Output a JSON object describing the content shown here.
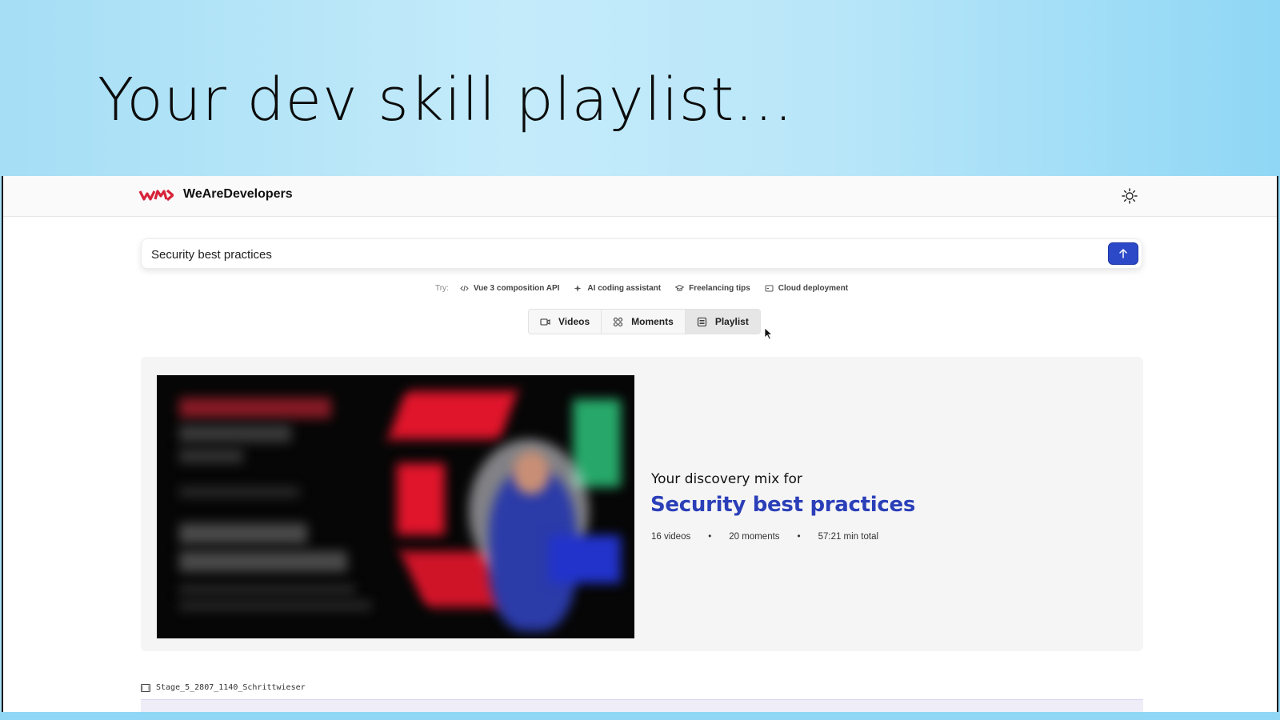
{
  "slide": {
    "title": "Your dev skill playlist..."
  },
  "header": {
    "brand": "WeAreDevelopers",
    "logo_icon": "wad-logo-icon",
    "theme_icon": "sun-icon"
  },
  "search": {
    "value": "Security best practices",
    "submit_icon": "arrow-up-icon"
  },
  "suggestions": {
    "label": "Try:",
    "items": [
      {
        "label": "Vue 3 composition API",
        "icon": "code-icon"
      },
      {
        "label": "AI coding assistant",
        "icon": "sparkle-icon"
      },
      {
        "label": "Freelancing tips",
        "icon": "graduation-cap-icon"
      },
      {
        "label": "Cloud deployment",
        "icon": "server-icon"
      }
    ]
  },
  "tabs": [
    {
      "label": "Videos",
      "icon": "video-icon",
      "active": false
    },
    {
      "label": "Moments",
      "icon": "grid-icon",
      "active": false
    },
    {
      "label": "Playlist",
      "icon": "list-icon",
      "active": true
    }
  ],
  "playlist": {
    "subtitle": "Your discovery mix for",
    "title": "Security best practices",
    "stats": {
      "videos": "16 videos",
      "moments": "20 moments",
      "duration": "57:21 min total"
    }
  },
  "next_item": {
    "filename": "Stage_5_2807_1140_Schrittwieser",
    "icon": "film-icon"
  },
  "colors": {
    "accent": "#2c49c8",
    "title_blue": "#2b3fb8",
    "brand_red": "#d6243a"
  }
}
